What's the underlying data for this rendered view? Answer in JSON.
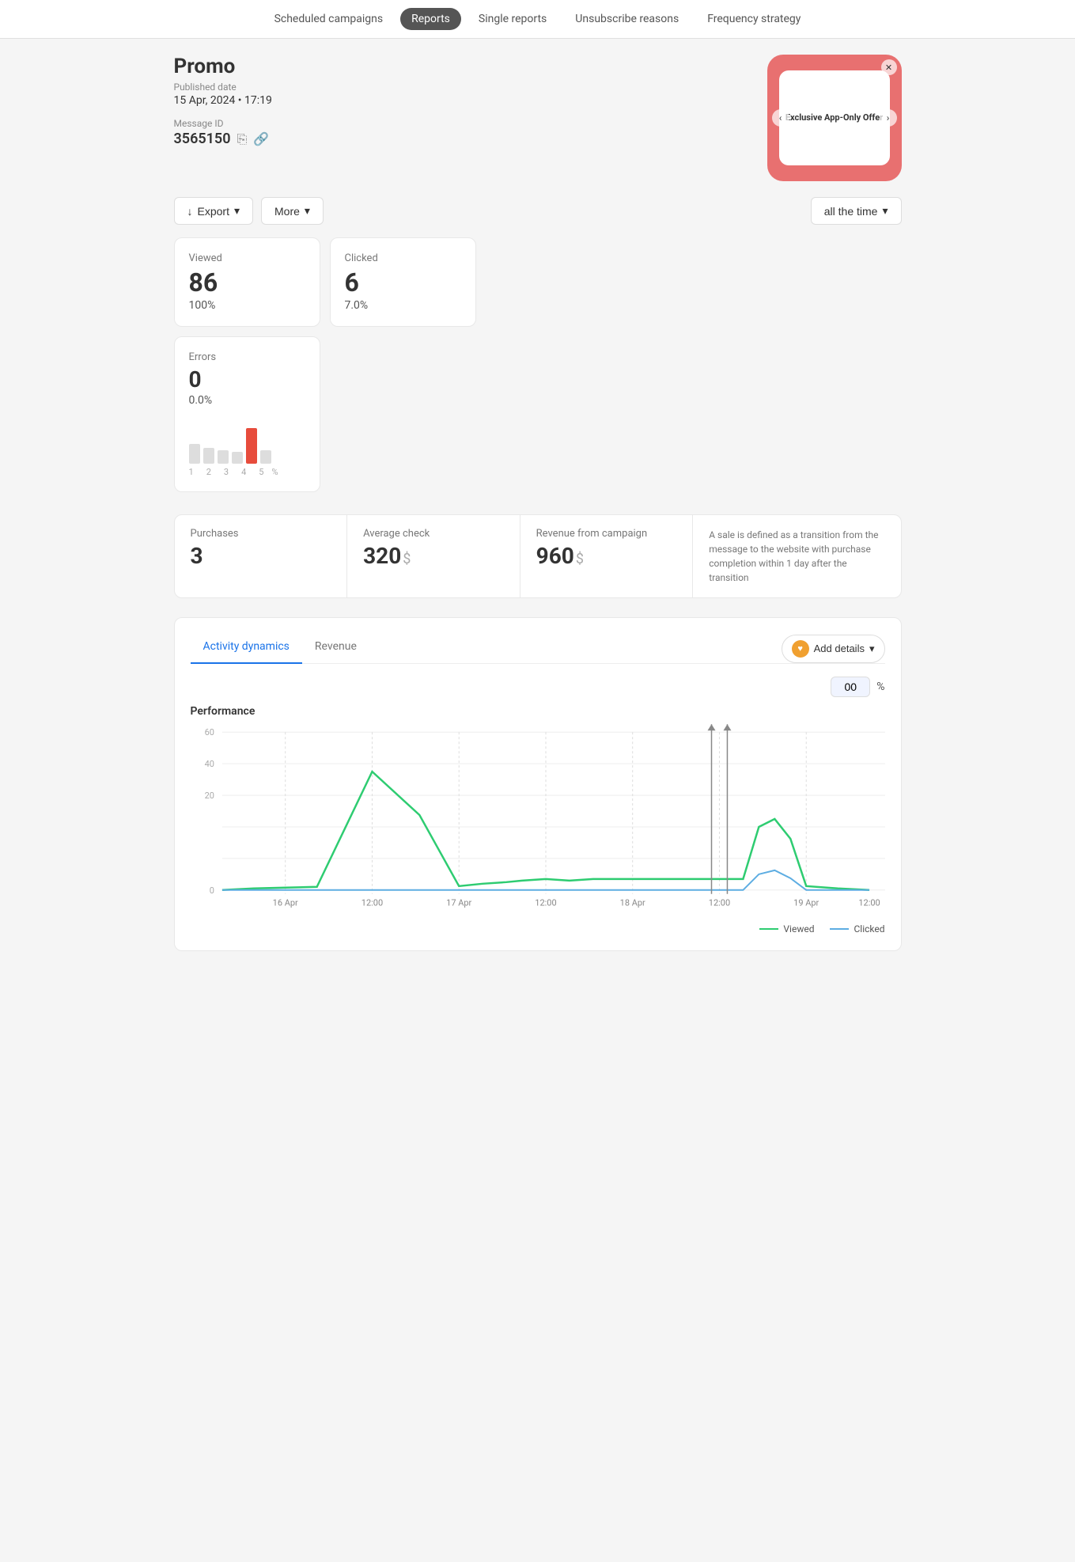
{
  "nav": {
    "items": [
      {
        "label": "Scheduled campaigns",
        "active": false
      },
      {
        "label": "Reports",
        "active": true
      },
      {
        "label": "Single reports",
        "active": false
      },
      {
        "label": "Unsubscribe reasons",
        "active": false
      },
      {
        "label": "Frequency strategy",
        "active": false
      }
    ]
  },
  "page": {
    "title": "Promo",
    "published_label": "Published date",
    "published_value": "15 Apr, 2024 • 17:19",
    "message_label": "Message ID",
    "message_id": "3565150"
  },
  "preview": {
    "text": "Exclusive App-Only Offer"
  },
  "toolbar": {
    "export_label": "Export",
    "more_label": "More",
    "time_label": "all the time"
  },
  "stats": {
    "viewed_label": "Viewed",
    "viewed_value": "86",
    "viewed_percent": "100%",
    "clicked_label": "Clicked",
    "clicked_value": "6",
    "clicked_percent": "7.0%",
    "errors_label": "Errors",
    "errors_value": "0",
    "errors_percent": "0.0%"
  },
  "purchases": {
    "label": "Purchases",
    "value": "3",
    "avg_check_label": "Average check",
    "avg_check_value": "320",
    "avg_check_currency": "$",
    "revenue_label": "Revenue from campaign",
    "revenue_value": "960",
    "revenue_currency": "$",
    "note": "A sale is defined as a transition from the message to the website with purchase completion within 1 day after the transition"
  },
  "activity": {
    "tab1": "Activity dynamics",
    "tab2": "Revenue",
    "add_details": "Add details",
    "percent_value": "00",
    "chart_title": "Performance",
    "y_labels": [
      "60",
      "40",
      "20",
      "0"
    ],
    "x_labels": [
      "16 Apr",
      "12:00",
      "17 Apr",
      "12:00",
      "18 Apr",
      "12:00",
      "19 Apr",
      "12:00"
    ],
    "legend_viewed": "Viewed",
    "legend_clicked": "Clicked"
  }
}
